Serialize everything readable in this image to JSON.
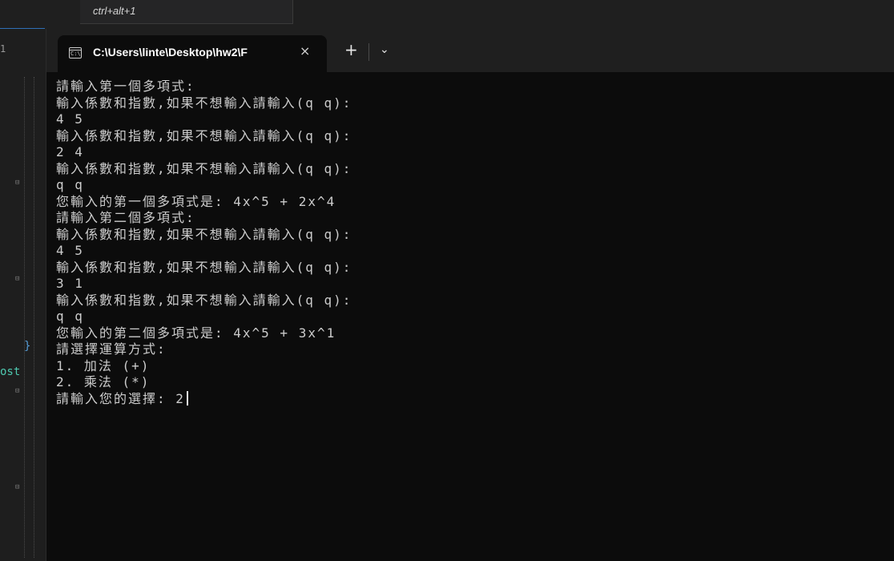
{
  "ide": {
    "tooltip_text": "ctrl+alt+1",
    "gutter_line_number": "1",
    "gutter_brace": "}",
    "gutter_ost": "ost"
  },
  "terminal": {
    "tab_title": "C:\\Users\\linte\\Desktop\\hw2\\F",
    "tab_icon_text": "C:\\",
    "close_glyph": "×",
    "new_tab_glyph": "+",
    "dropdown_glyph": "⌄",
    "lines": [
      "請輸入第一個多項式:",
      "輸入係數和指數,如果不想輸入請輸入(q q):",
      "4 5",
      "輸入係數和指數,如果不想輸入請輸入(q q):",
      "2 4",
      "輸入係數和指數,如果不想輸入請輸入(q q):",
      "q q",
      "您輸入的第一個多項式是: 4x^5 + 2x^4",
      "請輸入第二個多項式:",
      "輸入係數和指數,如果不想輸入請輸入(q q):",
      "4 5",
      "輸入係數和指數,如果不想輸入請輸入(q q):",
      "3 1",
      "輸入係數和指數,如果不想輸入請輸入(q q):",
      "q q",
      "您輸入的第二個多項式是: 4x^5 + 3x^1",
      "請選擇運算方式:",
      "1. 加法 (+)",
      "2. 乘法 (*)"
    ],
    "prompt_line": "請輸入您的選擇: 2"
  }
}
